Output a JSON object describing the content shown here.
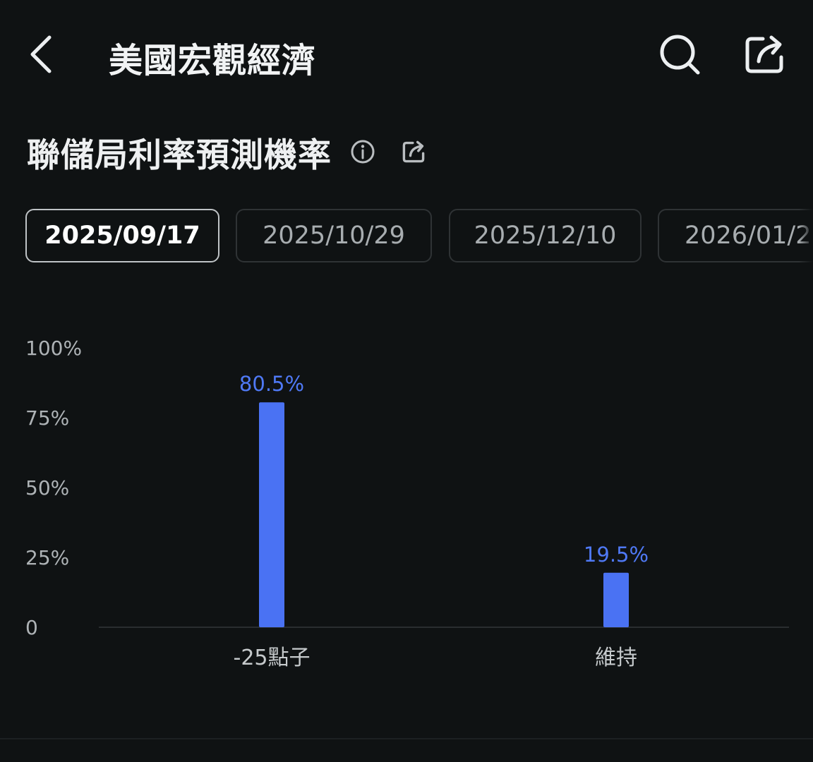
{
  "header": {
    "title": "美國宏觀經濟",
    "back_icon": "chevron-left-icon",
    "search_icon": "search-icon",
    "share_icon": "share-icon"
  },
  "section": {
    "title": "聯儲局利率預測機率",
    "info_icon": "info-icon",
    "share_icon": "share-icon"
  },
  "tabs": [
    {
      "label": "2025/09/17",
      "active": true
    },
    {
      "label": "2025/10/29",
      "active": false
    },
    {
      "label": "2025/12/10",
      "active": false
    },
    {
      "label": "2026/01/2",
      "active": false
    }
  ],
  "colors": {
    "background": "#0f1213",
    "bar": "#4a72f3",
    "value_label": "#4f79f5"
  },
  "chart_data": {
    "type": "bar",
    "categories": [
      "-25點子",
      "維持"
    ],
    "values": [
      80.5,
      19.5
    ],
    "value_labels": [
      "80.5%",
      "19.5%"
    ],
    "y_ticks": [
      "0",
      "25%",
      "50%",
      "75%",
      "100%"
    ],
    "ylim": [
      0,
      100
    ],
    "grid": false
  }
}
